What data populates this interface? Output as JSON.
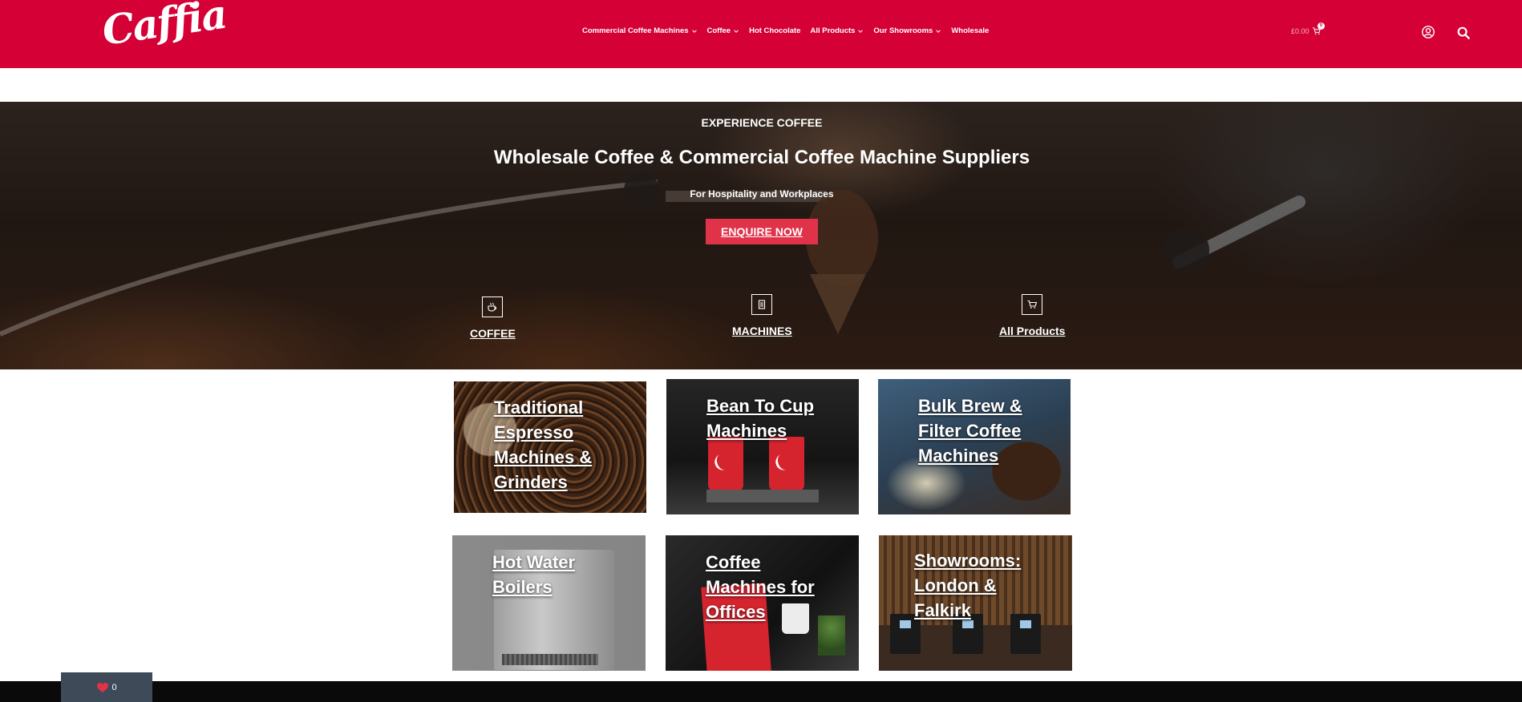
{
  "brand": {
    "logo_text": "Caffia",
    "color_primary": "#d40036",
    "color_cta": "#e0334a"
  },
  "nav": {
    "items": [
      {
        "label": "Commercial Coffee Machines",
        "has_dropdown": true
      },
      {
        "label": "Coffee",
        "has_dropdown": true
      },
      {
        "label": "Hot Chocolate",
        "has_dropdown": false
      },
      {
        "label": "All Products",
        "has_dropdown": true
      },
      {
        "label": "Our Showrooms",
        "has_dropdown": true
      },
      {
        "label": "Wholesale",
        "has_dropdown": false
      }
    ],
    "cart_total": "£0.00",
    "cart_count": "0"
  },
  "hero": {
    "eyebrow": "EXPERIENCE COFFEE",
    "title": "Wholesale Coffee & Commercial Coffee Machine Suppliers",
    "subtitle": "For Hospitality and Workplaces",
    "cta_label": "ENQUIRE NOW",
    "shortcuts": [
      {
        "label": "COFFEE",
        "icon": "coffee-cup-icon"
      },
      {
        "label": "MACHINES",
        "icon": "machine-icon"
      },
      {
        "label": "All Products",
        "icon": "shopping-cart-icon"
      }
    ]
  },
  "tiles": [
    {
      "label": "Traditional Espresso Machines & Grinders"
    },
    {
      "label": "Bean To Cup Machines"
    },
    {
      "label": "Bulk Brew & Filter Coffee Machines"
    },
    {
      "label": "Hot Water Boilers"
    },
    {
      "label": "Coffee Machines for Offices"
    },
    {
      "label": "Showrooms: London & Falkirk"
    }
  ],
  "wishlist": {
    "count": "0",
    "icon": "heart-icon"
  }
}
